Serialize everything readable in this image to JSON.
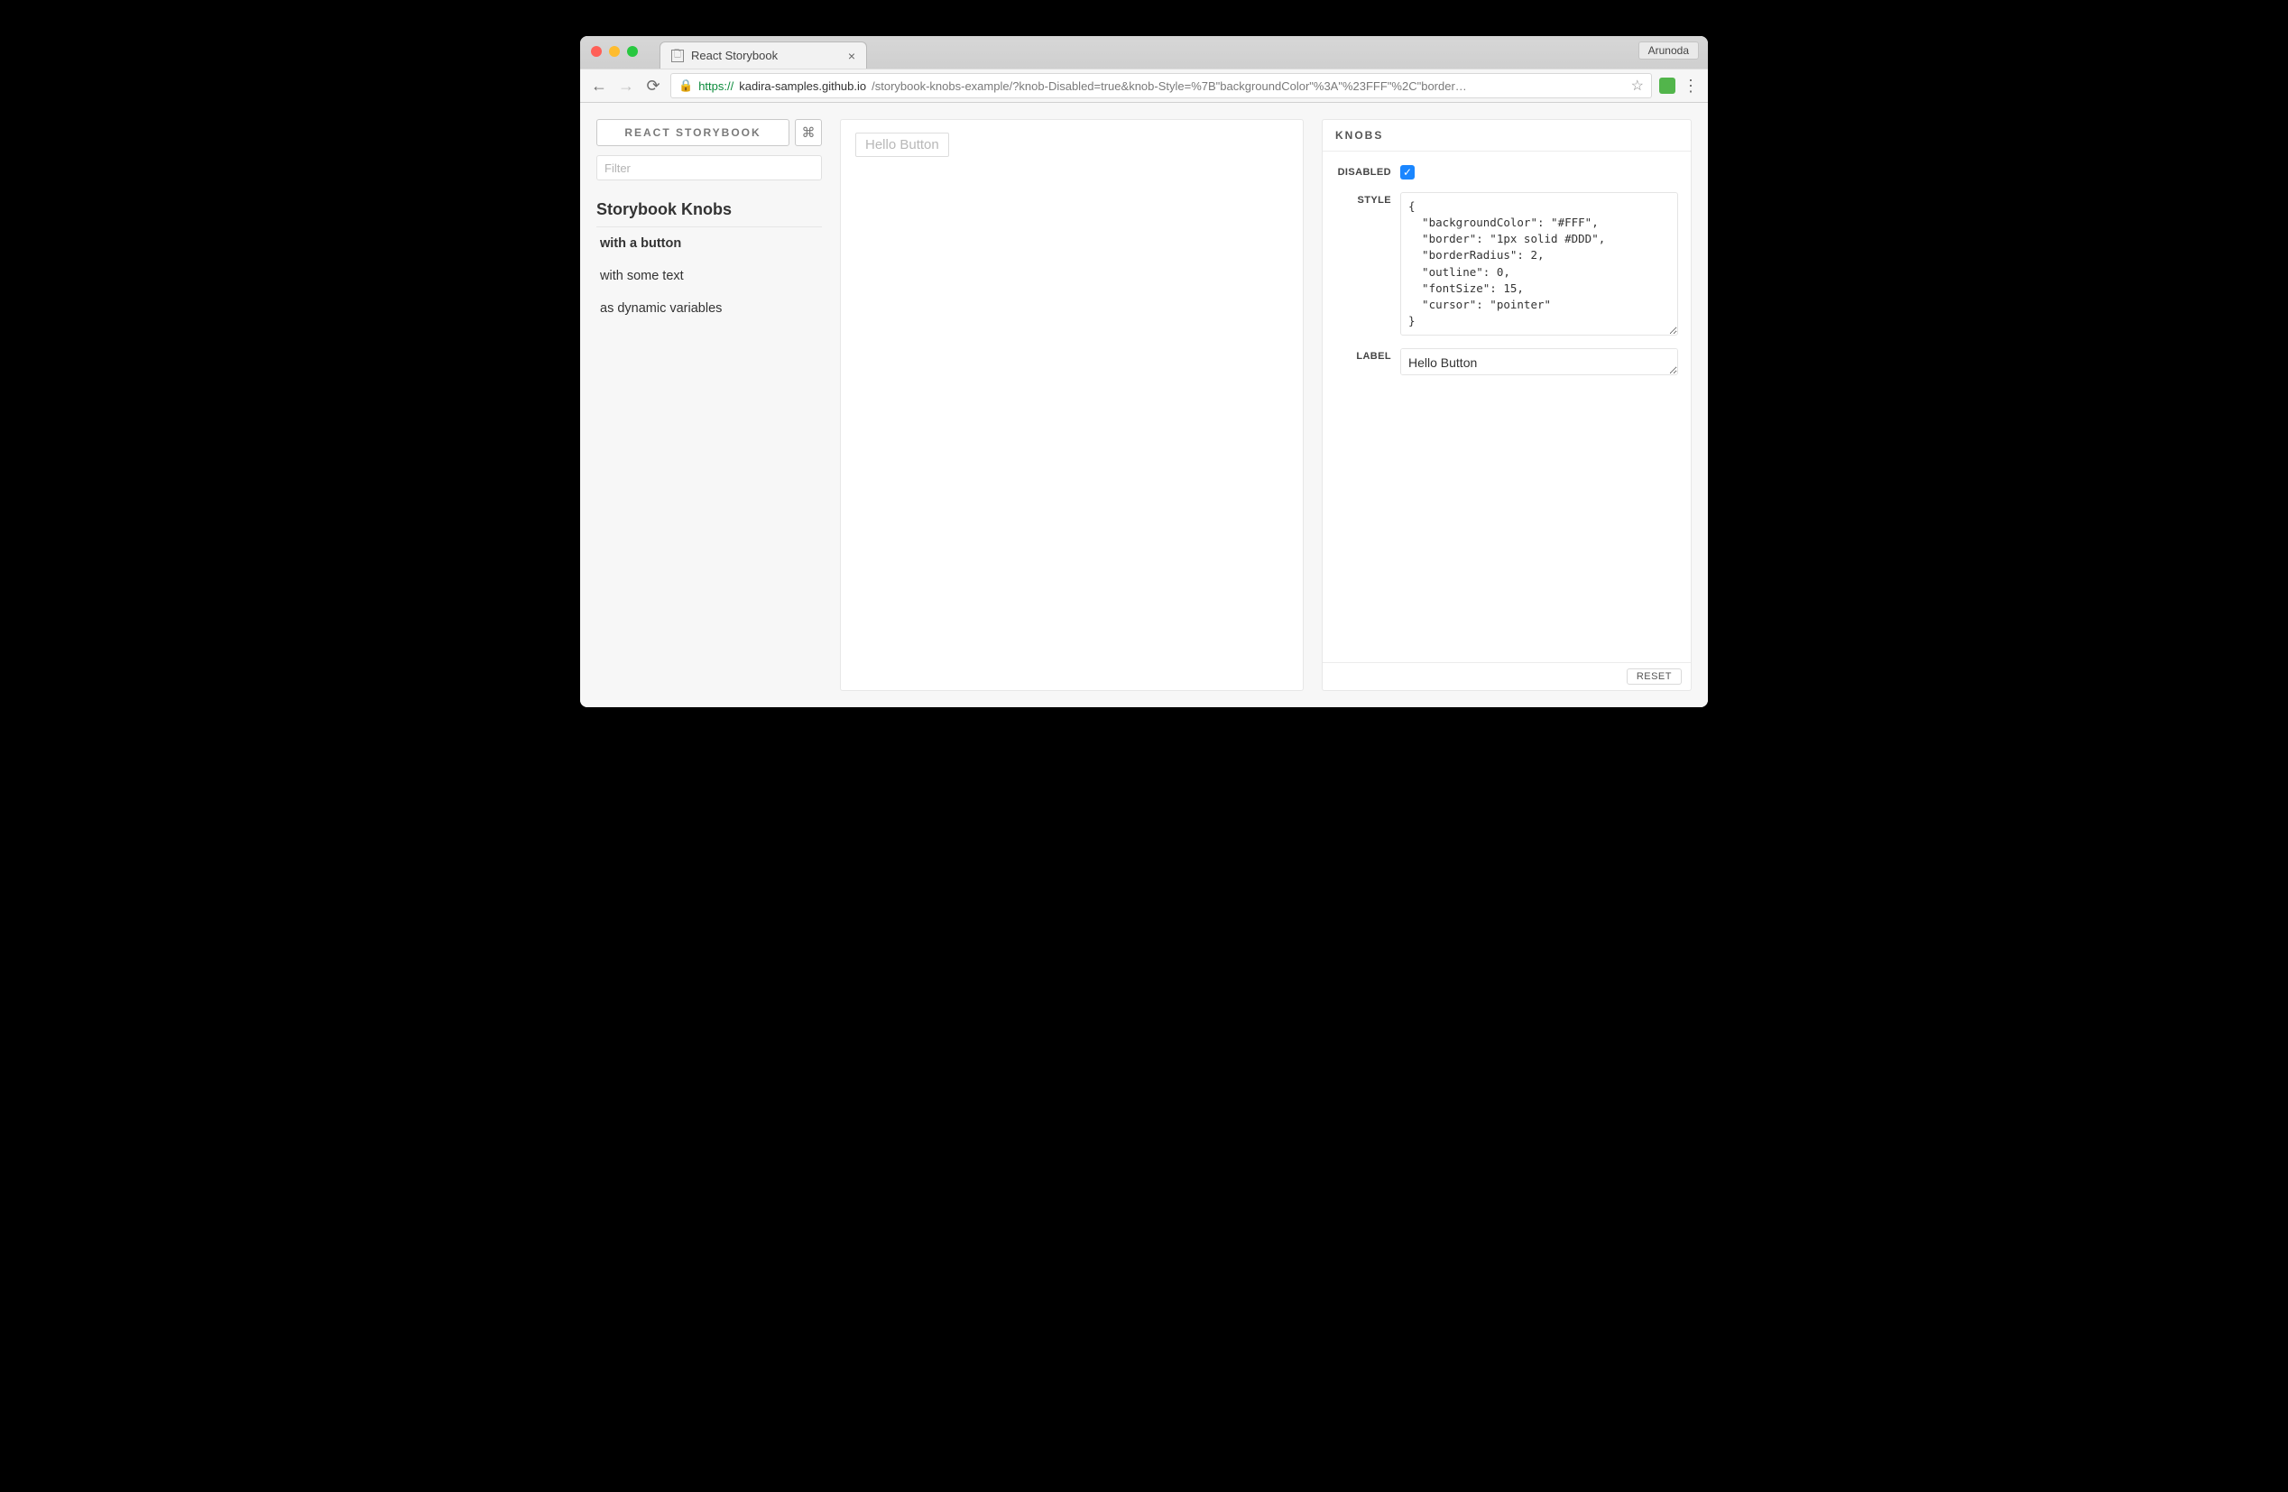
{
  "browser": {
    "tab_title": "React Storybook",
    "profile": "Arunoda",
    "url_scheme": "https://",
    "url_host": "kadira-samples.github.io",
    "url_path": "/storybook-knobs-example/?knob-Disabled=true&knob-Style=%7B\"backgroundColor\"%3A\"%23FFF\"%2C\"border…"
  },
  "sidebar": {
    "brand": "REACT STORYBOOK",
    "command_glyph": "⌘",
    "filter_placeholder": "Filter",
    "group_title": "Storybook Knobs",
    "stories": [
      {
        "label": "with a button",
        "active": true
      },
      {
        "label": "with some text",
        "active": false
      },
      {
        "label": "as dynamic variables",
        "active": false
      }
    ]
  },
  "preview": {
    "button_label": "Hello Button"
  },
  "knobs": {
    "title": "KNOBS",
    "disabled": {
      "label": "DISABLED",
      "checked": true
    },
    "style": {
      "label": "STYLE",
      "value": "{\n  \"backgroundColor\": \"#FFF\",\n  \"border\": \"1px solid #DDD\",\n  \"borderRadius\": 2,\n  \"outline\": 0,\n  \"fontSize\": 15,\n  \"cursor\": \"pointer\"\n}"
    },
    "label_knob": {
      "label": "LABEL",
      "value": "Hello Button"
    },
    "reset": "RESET"
  }
}
